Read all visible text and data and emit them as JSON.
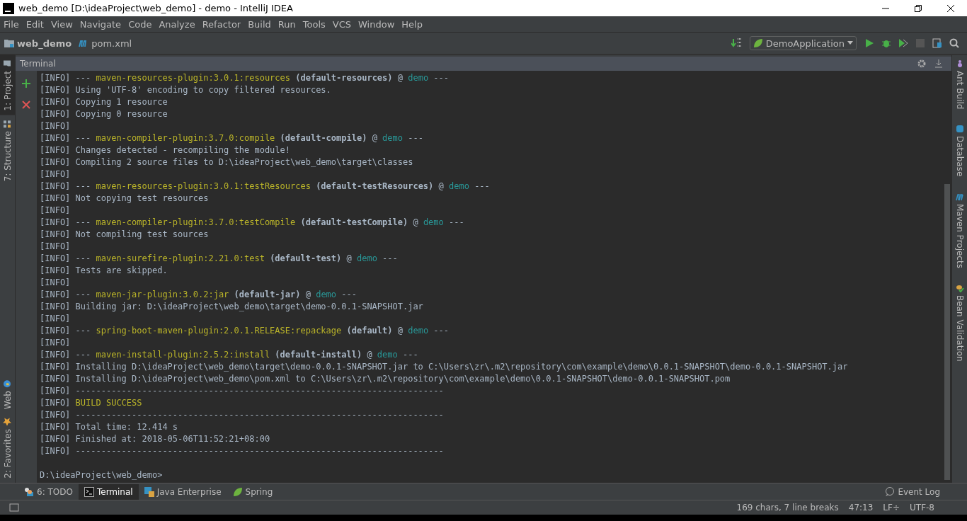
{
  "window": {
    "title": "web_demo [D:\\ideaProject\\web_demo] - demo - IntelliJ IDEA"
  },
  "menu": [
    "File",
    "Edit",
    "View",
    "Navigate",
    "Code",
    "Analyze",
    "Refactor",
    "Build",
    "Run",
    "Tools",
    "VCS",
    "Window",
    "Help"
  ],
  "breadcrumbs": [
    {
      "kind": "project",
      "label": "web_demo"
    },
    {
      "kind": "maven",
      "label": "pom.xml"
    }
  ],
  "run_config": {
    "label": "DemoApplication"
  },
  "left_tools": [
    {
      "label": "1: Project",
      "selected": true,
      "kind": "project"
    },
    {
      "label": "7: Structure",
      "selected": false,
      "kind": "structure"
    }
  ],
  "left_tools_bottom": [
    {
      "label": "Web",
      "selected": false,
      "kind": "web"
    },
    {
      "label": "2: Favorites",
      "selected": false,
      "kind": "favorites"
    }
  ],
  "right_tools": [
    {
      "label": "Ant Build",
      "kind": "ant"
    },
    {
      "label": "Database",
      "kind": "database"
    },
    {
      "label": "Maven Projects",
      "kind": "maven"
    },
    {
      "label": "Bean Validation",
      "kind": "bean"
    }
  ],
  "terminal": {
    "title": "Terminal",
    "lines": [
      [
        {
          "kind": "plain",
          "text": "[INFO] --- "
        },
        {
          "kind": "plugin",
          "text": "maven-resources-plugin:3.0.1:resources"
        },
        {
          "kind": "bold",
          "text": " (default-resources)"
        },
        {
          "kind": "plain",
          "text": " @ "
        },
        {
          "kind": "module",
          "text": "demo"
        },
        {
          "kind": "plain",
          "text": " ---"
        }
      ],
      [
        {
          "kind": "plain",
          "text": "[INFO] Using 'UTF-8' encoding to copy filtered resources."
        }
      ],
      [
        {
          "kind": "plain",
          "text": "[INFO] Copying 1 resource"
        }
      ],
      [
        {
          "kind": "plain",
          "text": "[INFO] Copying 0 resource"
        }
      ],
      [
        {
          "kind": "plain",
          "text": "[INFO]"
        }
      ],
      [
        {
          "kind": "plain",
          "text": "[INFO] --- "
        },
        {
          "kind": "plugin",
          "text": "maven-compiler-plugin:3.7.0:compile"
        },
        {
          "kind": "bold",
          "text": " (default-compile)"
        },
        {
          "kind": "plain",
          "text": " @ "
        },
        {
          "kind": "module",
          "text": "demo"
        },
        {
          "kind": "plain",
          "text": " ---"
        }
      ],
      [
        {
          "kind": "plain",
          "text": "[INFO] Changes detected - recompiling the module!"
        }
      ],
      [
        {
          "kind": "plain",
          "text": "[INFO] Compiling 2 source files to D:\\ideaProject\\web_demo\\target\\classes"
        }
      ],
      [
        {
          "kind": "plain",
          "text": "[INFO]"
        }
      ],
      [
        {
          "kind": "plain",
          "text": "[INFO] --- "
        },
        {
          "kind": "plugin",
          "text": "maven-resources-plugin:3.0.1:testResources"
        },
        {
          "kind": "bold",
          "text": " (default-testResources)"
        },
        {
          "kind": "plain",
          "text": " @ "
        },
        {
          "kind": "module",
          "text": "demo"
        },
        {
          "kind": "plain",
          "text": " ---"
        }
      ],
      [
        {
          "kind": "plain",
          "text": "[INFO] Not copying test resources"
        }
      ],
      [
        {
          "kind": "plain",
          "text": "[INFO]"
        }
      ],
      [
        {
          "kind": "plain",
          "text": "[INFO] --- "
        },
        {
          "kind": "plugin",
          "text": "maven-compiler-plugin:3.7.0:testCompile"
        },
        {
          "kind": "bold",
          "text": " (default-testCompile)"
        },
        {
          "kind": "plain",
          "text": " @ "
        },
        {
          "kind": "module",
          "text": "demo"
        },
        {
          "kind": "plain",
          "text": " ---"
        }
      ],
      [
        {
          "kind": "plain",
          "text": "[INFO] Not compiling test sources"
        }
      ],
      [
        {
          "kind": "plain",
          "text": "[INFO]"
        }
      ],
      [
        {
          "kind": "plain",
          "text": "[INFO] --- "
        },
        {
          "kind": "plugin",
          "text": "maven-surefire-plugin:2.21.0:test"
        },
        {
          "kind": "bold",
          "text": " (default-test)"
        },
        {
          "kind": "plain",
          "text": " @ "
        },
        {
          "kind": "module",
          "text": "demo"
        },
        {
          "kind": "plain",
          "text": " ---"
        }
      ],
      [
        {
          "kind": "plain",
          "text": "[INFO] Tests are skipped."
        }
      ],
      [
        {
          "kind": "plain",
          "text": "[INFO]"
        }
      ],
      [
        {
          "kind": "plain",
          "text": "[INFO] --- "
        },
        {
          "kind": "plugin",
          "text": "maven-jar-plugin:3.0.2:jar"
        },
        {
          "kind": "bold",
          "text": " (default-jar)"
        },
        {
          "kind": "plain",
          "text": " @ "
        },
        {
          "kind": "module",
          "text": "demo"
        },
        {
          "kind": "plain",
          "text": " ---"
        }
      ],
      [
        {
          "kind": "plain",
          "text": "[INFO] Building jar: D:\\ideaProject\\web_demo\\target\\demo-0.0.1-SNAPSHOT.jar"
        }
      ],
      [
        {
          "kind": "plain",
          "text": "[INFO]"
        }
      ],
      [
        {
          "kind": "plain",
          "text": "[INFO] --- "
        },
        {
          "kind": "plugin",
          "text": "spring-boot-maven-plugin:2.0.1.RELEASE:repackage"
        },
        {
          "kind": "bold",
          "text": " (default)"
        },
        {
          "kind": "plain",
          "text": " @ "
        },
        {
          "kind": "module",
          "text": "demo"
        },
        {
          "kind": "plain",
          "text": " ---"
        }
      ],
      [
        {
          "kind": "plain",
          "text": "[INFO]"
        }
      ],
      [
        {
          "kind": "plain",
          "text": "[INFO] --- "
        },
        {
          "kind": "plugin",
          "text": "maven-install-plugin:2.5.2:install"
        },
        {
          "kind": "bold",
          "text": " (default-install)"
        },
        {
          "kind": "plain",
          "text": " @ "
        },
        {
          "kind": "module",
          "text": "demo"
        },
        {
          "kind": "plain",
          "text": " ---"
        }
      ],
      [
        {
          "kind": "plain",
          "text": "[INFO] Installing D:\\ideaProject\\web_demo\\target\\demo-0.0.1-SNAPSHOT.jar to C:\\Users\\zr\\.m2\\repository\\com\\example\\demo\\0.0.1-SNAPSHOT\\demo-0.0.1-SNAPSHOT.jar"
        }
      ],
      [
        {
          "kind": "plain",
          "text": "[INFO] Installing D:\\ideaProject\\web_demo\\pom.xml to C:\\Users\\zr\\.m2\\repository\\com\\example\\demo\\0.0.1-SNAPSHOT\\demo-0.0.1-SNAPSHOT.pom"
        }
      ],
      [
        {
          "kind": "plain",
          "text": "[INFO] ------------------------------------------------------------------------"
        }
      ],
      [
        {
          "kind": "plain",
          "text": "[INFO] "
        },
        {
          "kind": "success",
          "text": "BUILD SUCCESS"
        }
      ],
      [
        {
          "kind": "plain",
          "text": "[INFO] ------------------------------------------------------------------------"
        }
      ],
      [
        {
          "kind": "plain",
          "text": "[INFO] Total time: 12.414 s"
        }
      ],
      [
        {
          "kind": "plain",
          "text": "[INFO] Finished at: 2018-05-06T11:52:21+08:00"
        }
      ],
      [
        {
          "kind": "plain",
          "text": "[INFO] ------------------------------------------------------------------------"
        }
      ]
    ],
    "prompt": "D:\\ideaProject\\web_demo>"
  },
  "bottom_tabs": [
    {
      "label": "6: TODO",
      "kind": "todo",
      "selected": false
    },
    {
      "label": "Terminal",
      "kind": "terminal",
      "selected": true
    },
    {
      "label": "Java Enterprise",
      "kind": "javaee",
      "selected": false
    },
    {
      "label": "Spring",
      "kind": "spring",
      "selected": false
    }
  ],
  "event_log": "Event Log",
  "status_bar": [
    "169 chars, 7 line breaks",
    "47:13",
    "LF÷",
    "UTF-8"
  ]
}
